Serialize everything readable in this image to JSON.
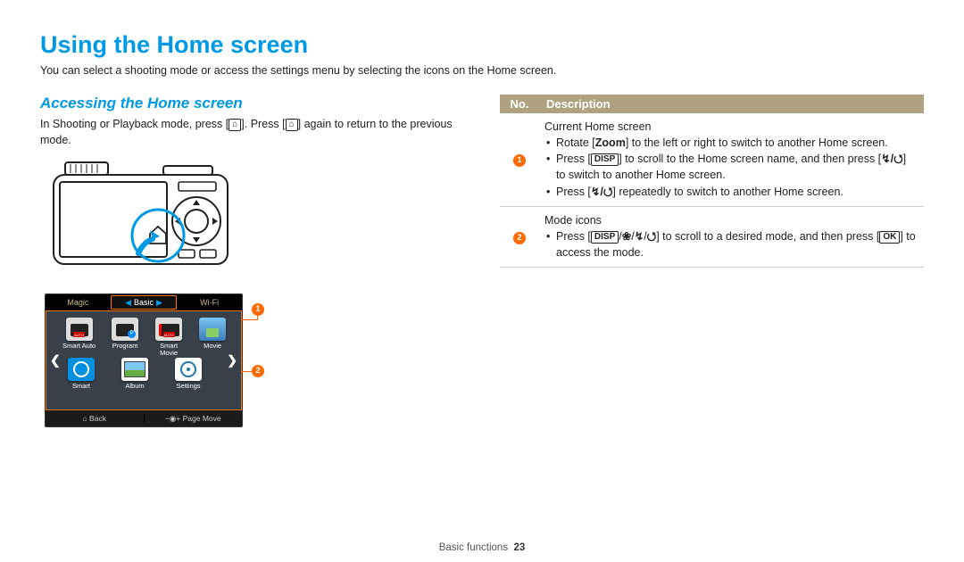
{
  "main_title": "Using the Home screen",
  "intro": "You can select a shooting mode or access the settings menu by selecting the icons on the Home screen.",
  "sub_title": "Accessing the Home screen",
  "sub_desc_pre": "In Shooting or Playback mode, press [",
  "sub_desc_mid": "]. Press [",
  "sub_desc_post": "] again to return to the previous mode.",
  "tabs": {
    "left": "Magic",
    "center": "Basic",
    "right": "Wi-Fi"
  },
  "icons": {
    "r1": [
      "Smart Auto",
      "Program",
      "Smart\nMovie",
      "Movie"
    ],
    "r2": [
      "Smart",
      "Album",
      "Settings"
    ]
  },
  "hs_footer": {
    "back": "Back",
    "page_move": "Page Move"
  },
  "callouts": {
    "one": "1",
    "two": "2"
  },
  "table": {
    "h1": "No.",
    "h2": "Description",
    "row1_title": "Current Home screen",
    "row1_b1_pre": "Rotate [",
    "row1_b1_zoom": "Zoom",
    "row1_b1_post": "] to the left or right to switch to another Home screen.",
    "row1_b2_pre": "Press [",
    "row1_b2_disp": "DISP",
    "row1_b2_mid": "] to scroll to the Home screen name, and then press [",
    "row1_b2_ft": "  /  ",
    "row1_b2_post": "] to switch to another Home screen.",
    "row1_b3_pre": "Press [",
    "row1_b3_ft": "  /  ",
    "row1_b3_post": "] repeatedly to switch to another Home screen.",
    "row2_title": "Mode icons",
    "row2_b1_pre": "Press [",
    "row2_b1_disp": "DISP",
    "row2_b1_sep1": "/",
    "row2_b1_sep2": "/",
    "row2_b1_sep3": "/",
    "row2_b1_mid": "] to scroll to a desired mode, and then press [",
    "row2_b1_ok": "OK",
    "row2_b1_post": "] to access the mode."
  },
  "footer_section": "Basic functions",
  "footer_page": "23",
  "inline_icons": {
    "home": "⌂",
    "flash": "↯",
    "timer": "⭯",
    "macro": "❀"
  }
}
